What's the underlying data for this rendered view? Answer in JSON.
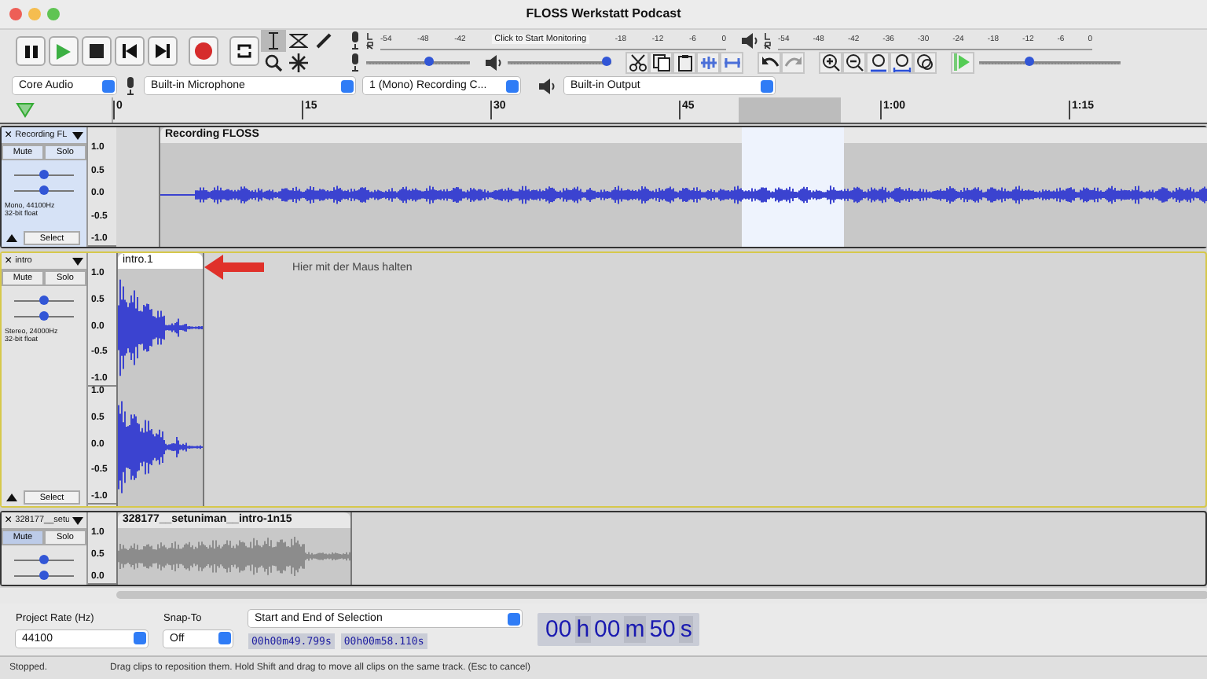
{
  "window": {
    "title": "FLOSS Werkstatt Podcast"
  },
  "record_meter": {
    "ticks": [
      "-54",
      "-48",
      "-42"
    ],
    "monitor_label": "Click to Start Monitoring",
    "ticks_end": [
      "-18",
      "-12",
      "-6",
      "0"
    ]
  },
  "playback_meter": {
    "ticks": [
      "-54",
      "-48",
      "-42",
      "-36",
      "-30",
      "-24",
      "-18",
      "-12",
      "-6",
      "0"
    ]
  },
  "record_volume": {
    "level": 0.6
  },
  "playback_volume": {
    "level": 0.95
  },
  "play_speed": {
    "level": 0.35
  },
  "devices": {
    "host": "Core Audio",
    "input": "Built-in Microphone",
    "channels": "1 (Mono) Recording C...",
    "output": "Built-in Output"
  },
  "ruler": {
    "ticks": [
      "0",
      "15",
      "30",
      "45",
      "1:00",
      "1:15"
    ]
  },
  "tracks": [
    {
      "close": "×",
      "name": "Recording FL",
      "selected": true,
      "focused": false,
      "mute": {
        "label": "Mute",
        "on": false
      },
      "solo": {
        "label": "Solo",
        "on": false
      },
      "gain": {
        "level": 0.5
      },
      "pan": {
        "level": 0.5
      },
      "info": [
        "Mono, 44100Hz",
        "32-bit float"
      ],
      "select": "Select",
      "clip": {
        "name": "Recording FLOSS"
      },
      "kind": "speech",
      "channels": [
        {
          "axis": [
            "1.0",
            "0.5",
            "0.0",
            "-0.5",
            "-1.0"
          ]
        }
      ]
    },
    {
      "close": "×",
      "name": "intro",
      "selected": false,
      "focused": true,
      "mute": {
        "label": "Mute",
        "on": false
      },
      "solo": {
        "label": "Solo",
        "on": false
      },
      "gain": {
        "level": 0.5
      },
      "pan": {
        "level": 0.5
      },
      "info": [
        "Stereo, 24000Hz",
        "32-bit float"
      ],
      "select": "Select",
      "clip": {
        "name": "intro.1"
      },
      "kind": "decay",
      "channels": [
        {
          "axis": [
            "1.0",
            "0.5",
            "0.0",
            "-0.5",
            "-1.0"
          ]
        },
        {
          "axis": [
            "1.0",
            "0.5",
            "0.0",
            "-0.5",
            "-1.0"
          ]
        }
      ]
    },
    {
      "close": "×",
      "name": "328177__setu",
      "selected": false,
      "focused": false,
      "mute": {
        "label": "Mute",
        "on": true
      },
      "solo": {
        "label": "Solo",
        "on": false
      },
      "gain": {
        "level": 0.5
      },
      "pan": {
        "level": 0.5
      },
      "clip": {
        "name": "328177__setuniman__intro-1n15"
      },
      "kind": "music",
      "channels": [
        {
          "axis": [
            "1.0",
            "0.5",
            "0.0"
          ]
        }
      ]
    }
  ],
  "annotation": {
    "text": "Hier mit der Maus halten"
  },
  "selection_toolbar": {
    "rate_label": "Project Rate (Hz)",
    "rate": "44100",
    "snap_label": "Snap-To",
    "snap": "Off",
    "mode": "Start and End of Selection",
    "start": "00h00m49.799s",
    "end": "00h00m58.110s",
    "time": [
      "00",
      "h",
      "00",
      "m",
      "50",
      "s"
    ]
  },
  "status": {
    "state": "Stopped.",
    "message": "Drag clips to reposition them. Hold Shift and drag to move all clips on the same track. (Esc to cancel)"
  }
}
